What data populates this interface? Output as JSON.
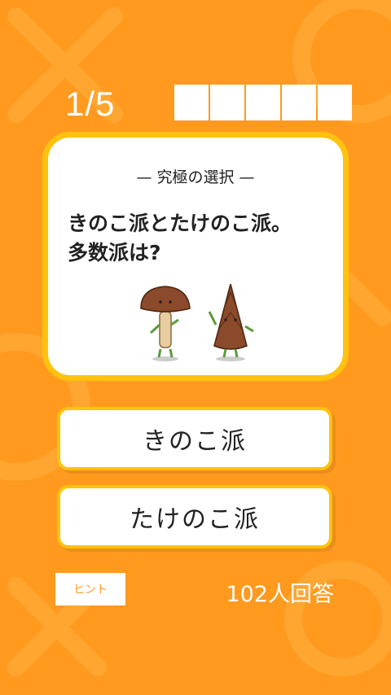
{
  "progress": {
    "current_label": "1/5",
    "total_boxes": 5
  },
  "card": {
    "label": "—  究極の選択  —",
    "question_line1": "きのこ派とたけのこ派。",
    "question_line2": "多数派は?"
  },
  "answers": {
    "option1": "きのこ派",
    "option2": "たけのこ派"
  },
  "footer": {
    "hint_label": "ヒント",
    "answer_count": "102人回答"
  },
  "colors": {
    "background": "#FF9A1F",
    "accent": "#FFC20E"
  }
}
